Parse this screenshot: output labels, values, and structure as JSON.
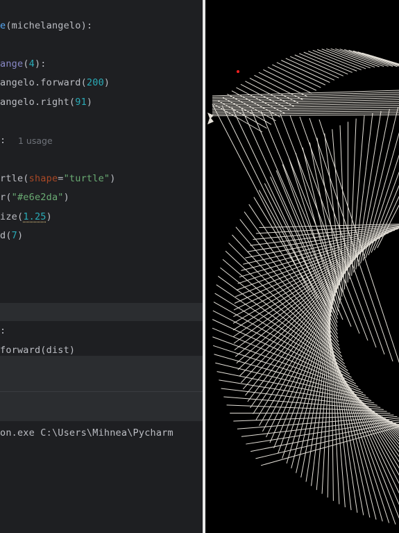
{
  "editor": {
    "lines": [
      {
        "segments": [
          {
            "t": "e",
            "c": "fn"
          },
          {
            "t": "(michelangelo):",
            "c": ""
          }
        ]
      },
      {
        "segments": [
          {
            "t": "ange",
            "c": "bi"
          },
          {
            "t": "(",
            "c": ""
          },
          {
            "t": "4",
            "c": "num"
          },
          {
            "t": "):",
            "c": ""
          }
        ]
      },
      {
        "segments": [
          {
            "t": "angelo.forward(",
            "c": ""
          },
          {
            "t": "200",
            "c": "num"
          },
          {
            "t": ")",
            "c": ""
          }
        ]
      },
      {
        "segments": [
          {
            "t": "angelo.right(",
            "c": ""
          },
          {
            "t": "91",
            "c": "num"
          },
          {
            "t": ")",
            "c": ""
          }
        ]
      },
      {
        "segments": [
          {
            "t": ":",
            "c": ""
          }
        ]
      },
      {
        "segments": [
          {
            "t": "rtle(",
            "c": ""
          },
          {
            "t": "shape",
            "c": "param"
          },
          {
            "t": "=",
            "c": ""
          },
          {
            "t": "\"turtle\"",
            "c": "str"
          },
          {
            "t": ")",
            "c": ""
          }
        ]
      },
      {
        "segments": [
          {
            "t": "r(",
            "c": ""
          },
          {
            "t": "\"#e6e2da\"",
            "c": "str"
          },
          {
            "t": ")",
            "c": ""
          }
        ]
      },
      {
        "segments": [
          {
            "t": "ize(",
            "c": ""
          },
          {
            "t": "1.25",
            "c": "num dots"
          },
          {
            "t": ")",
            "c": ""
          }
        ]
      },
      {
        "segments": [
          {
            "t": "d(",
            "c": ""
          },
          {
            "t": "7",
            "c": "num"
          },
          {
            "t": ")",
            "c": ""
          }
        ]
      }
    ],
    "usage_hint": "1 usage"
  },
  "lower_editor": {
    "lines": [
      {
        "segments": [
          {
            "t": ":",
            "c": ""
          }
        ]
      },
      {
        "segments": [
          {
            "t": "forward(dist)",
            "c": ""
          }
        ]
      }
    ]
  },
  "console": {
    "command": "on.exe C:\\Users\\Mihnea\\Pycharm"
  },
  "turtle_canvas": {
    "background": "#000000",
    "line_color": "#e6e2da",
    "pen_size": 1.25,
    "speed": 7,
    "forward": 200,
    "right_angle": 91,
    "steps": 4
  }
}
